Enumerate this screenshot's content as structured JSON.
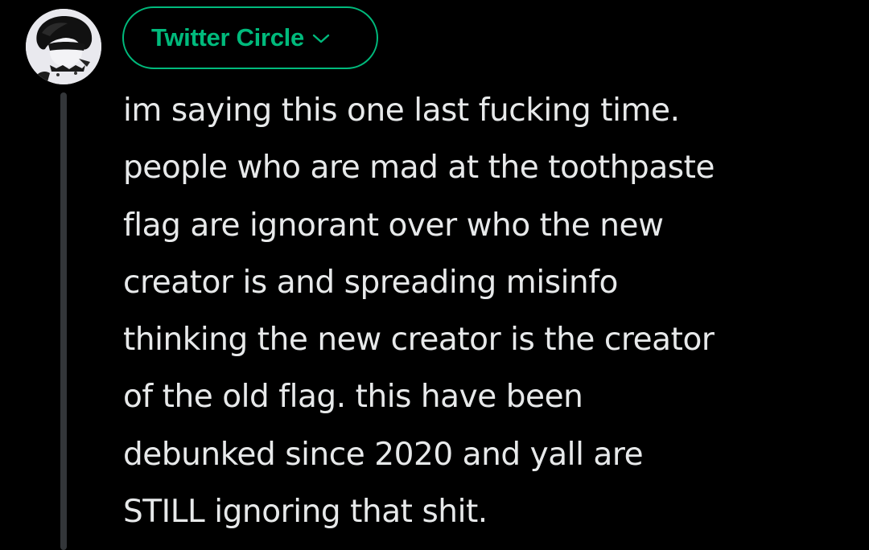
{
  "composer": {
    "audience_label": "Twitter Circle",
    "audience_icon": "chevron-down-icon",
    "accent_color": "#00ba7c",
    "background_color": "#000000",
    "text_color": "#e7e9ea",
    "avatar_icon": "user-avatar"
  },
  "tweet": {
    "lines": [
      "im saying this one last fucking time.",
      "people who are mad at the toothpaste",
      "flag are ignorant over who the new",
      "creator is and spreading misinfo",
      "thinking the new creator is the creator",
      "of the old flag. this have been",
      "debunked since 2020 and yall are",
      "STILL ignoring that shit."
    ]
  }
}
